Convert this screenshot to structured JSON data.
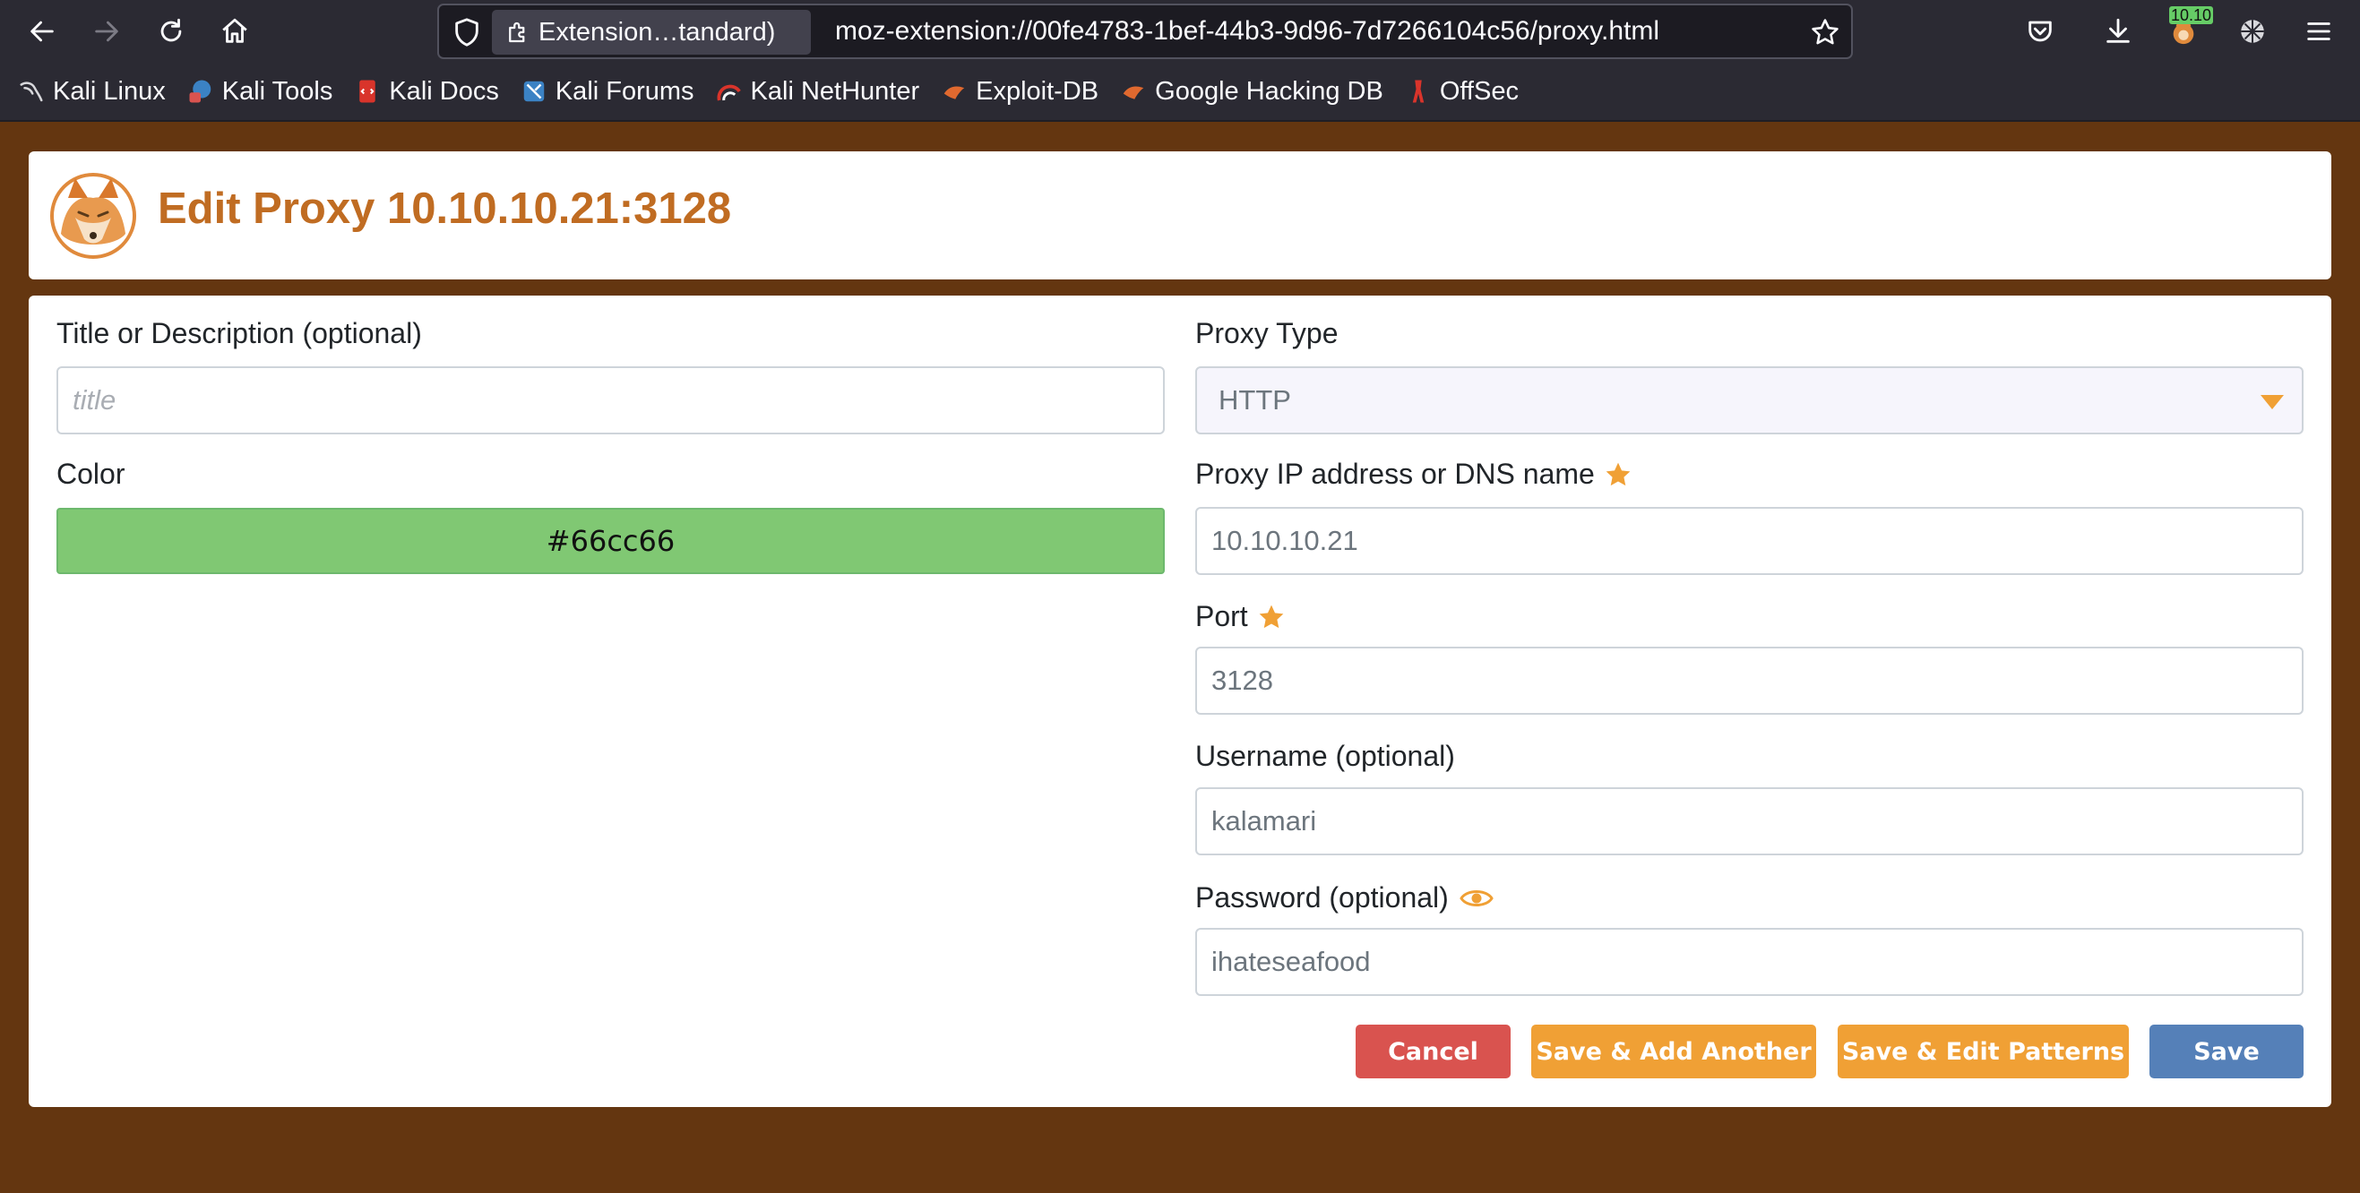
{
  "browser": {
    "url_identity": "Extension…tandard)",
    "url": "moz-extension://00fe4783-1bef-44b3-9d96-7d7266104c56/proxy.html",
    "badge_text": "10.10",
    "bookmarks": [
      {
        "label": "Kali Linux",
        "icon": "kali-dragon-icon"
      },
      {
        "label": "Kali Tools",
        "icon": "kali-tools-icon"
      },
      {
        "label": "Kali Docs",
        "icon": "kali-docs-icon"
      },
      {
        "label": "Kali Forums",
        "icon": "kali-forums-icon"
      },
      {
        "label": "Kali NetHunter",
        "icon": "kali-nethunter-icon"
      },
      {
        "label": "Exploit-DB",
        "icon": "exploit-db-icon"
      },
      {
        "label": "Google Hacking DB",
        "icon": "ghdb-icon"
      },
      {
        "label": "OffSec",
        "icon": "offsec-icon"
      }
    ]
  },
  "header": {
    "title": "Edit Proxy 10.10.10.21:3128"
  },
  "form": {
    "title_label": "Title or Description (optional)",
    "title_placeholder": "title",
    "color_label": "Color",
    "color_value": "#66cc66",
    "proxy_type_label": "Proxy Type",
    "proxy_type_value": "HTTP",
    "address_label": "Proxy IP address or DNS name",
    "address_value": "10.10.10.21",
    "port_label": "Port",
    "port_value": "3128",
    "username_label": "Username (optional)",
    "username_value": "kalamari",
    "password_label": "Password (optional)",
    "password_value": "ihateseafood"
  },
  "buttons": {
    "cancel": "Cancel",
    "save_add_another": "Save & Add Another",
    "save_edit_patterns": "Save & Edit Patterns",
    "save": "Save"
  },
  "colors": {
    "page_background": "#643610",
    "accent_orange": "#c06c22",
    "cancel": "#d9534f",
    "warning": "#f0a035",
    "primary": "#5580b8",
    "proxy_color": "#66cc66"
  }
}
